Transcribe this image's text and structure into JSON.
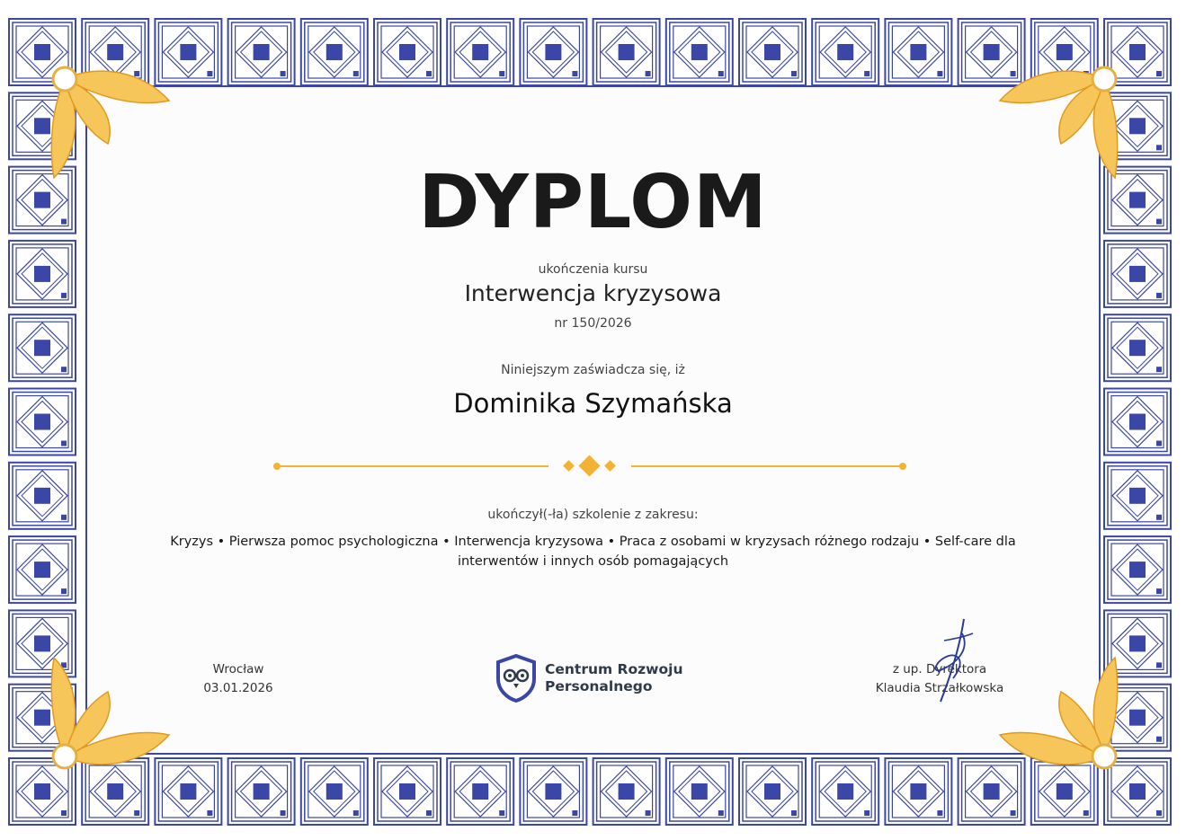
{
  "certificate": {
    "title": "DYPLOM",
    "course_intro": "ukończenia kursu",
    "course_name": "Interwencja kryzysowa",
    "course_number": "nr 150/2026",
    "certify_text": "Niniejszym zaświadcza się, iż",
    "recipient": "Dominika Szymańska",
    "completed_text": "ukończył(-ła) szkolenie z zakresu:",
    "topics": "Kryzys • Pierwsza pomoc psychologiczna • Interwencja kryzysowa • Praca z osobami w kryzysach różnego rodzaju • Self-care dla interwentów i innych osób pomagających"
  },
  "footer": {
    "place": "Wrocław",
    "date": "03.01.2026",
    "organization_line1": "Centrum Rozwoju",
    "organization_line2": "Personalnego",
    "director_role": "z up. Dyrektora",
    "director_name": "Klaudia Strzałkowska"
  },
  "colors": {
    "border_blue": "#3b47a6",
    "ornament_gold": "#f2b233",
    "text_dark": "#1a1a1a"
  },
  "icons": {
    "logo": "owl-shield-icon",
    "corner": "golden-leaf-ornament",
    "divider": "diamond-divider"
  }
}
